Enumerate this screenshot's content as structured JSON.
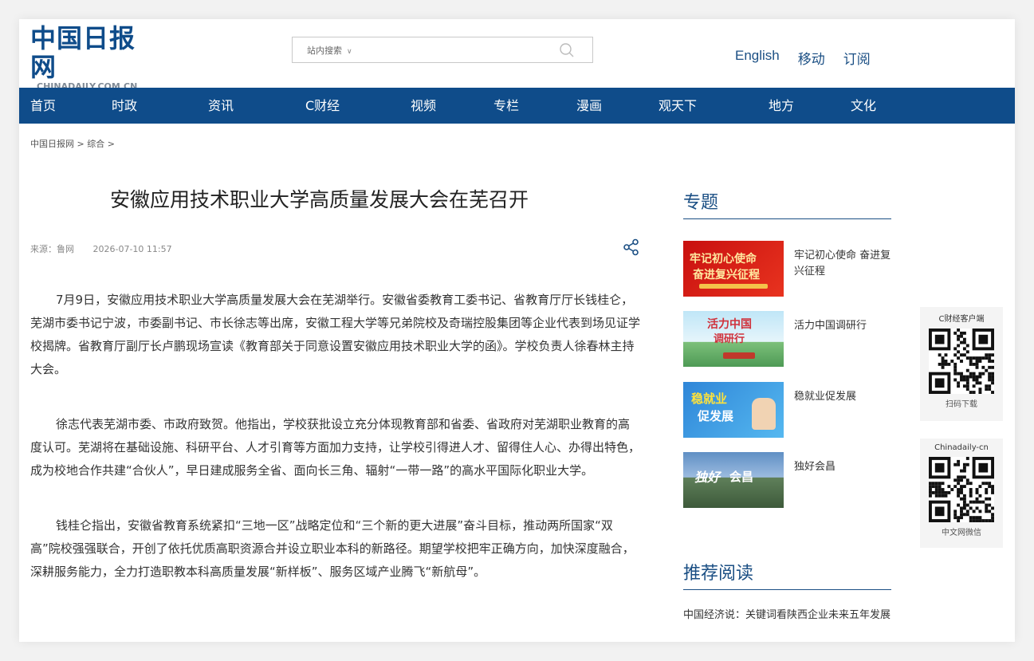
{
  "header": {
    "logo_cn": "中国日报网",
    "logo_en": "CHINADAILY.COM.CN",
    "search_scope": "站内搜索",
    "search_placeholder": "",
    "links": [
      "English",
      "移动",
      "订阅"
    ]
  },
  "nav": {
    "items": [
      "首页",
      "时政",
      "资讯",
      "C财经",
      "视频",
      "专栏",
      "漫画",
      "观天下",
      "地方",
      "文化"
    ]
  },
  "breadcrumb": {
    "home": "中国日报网",
    "sep1": ">",
    "section": "综合",
    "sep2": ">"
  },
  "article": {
    "title": "安徽应用技术职业大学高质量发展大会在芜召开",
    "source": "来源：鲁网",
    "date": "2026-07-10 11:57",
    "paragraphs": [
      "7月9日，安徽应用技术职业大学高质量发展大会在芜湖举行。安徽省委教育工委书记、省教育厅厅长钱桂仑，芜湖市委书记宁波，市委副书记、市长徐志等出席，安徽工程大学等兄弟院校及奇瑞控股集团等企业代表到场见证学校揭牌。省教育厅副厅长卢鹏现场宣读《教育部关于同意设置安徽应用技术职业大学的函》。学校负责人徐春林主持大会。",
      "徐志代表芜湖市委、市政府致贺。他指出，学校获批设立充分体现教育部和省委、省政府对芜湖职业教育的高度认可。芜湖将在基础设施、科研平台、人才引育等方面加力支持，让学校引得进人才、留得住人心、办得出特色，成为校地合作共建“合伙人”，早日建成服务全省、面向长三角、辐射“一带一路”的高水平国际化职业大学。",
      "钱桂仑指出，安徽省教育系统紧扣“三地一区”战略定位和“三个新的更大进展”奋斗目标，推动两所国家“双高”院校强强联合，开创了依托优质高职资源合并设立职业本科的新路径。期望学校把牢正确方向，加快深度融合，深耕服务能力，全力打造职教本科高质量发展“新样板”、服务区域产业腾飞“新航母”。"
    ]
  },
  "sidebar": {
    "topics_heading": "专题",
    "topics": [
      {
        "caption": "牢记初心使命 奋进复兴征程",
        "thumb_line1": "牢记初心使命",
        "thumb_line2": "奋进复兴征程"
      },
      {
        "caption": "活力中国调研行",
        "thumb_line1": "活力中国",
        "thumb_line2": "调研行"
      },
      {
        "caption": "稳就业促发展",
        "thumb_line1": "稳就业",
        "thumb_line2": "促发展"
      },
      {
        "caption": "独好会昌",
        "thumb_line1": "独好",
        "thumb_line2": "会昌"
      }
    ],
    "recommend_heading": "推荐阅读",
    "recommend_first": "中国经济说：关键词看陕西企业未来五年发展"
  },
  "qr": [
    {
      "label": "C财经客户端",
      "footer": "扫码下载"
    },
    {
      "label": "Chinadaily-cn",
      "footer": "中文网微信"
    }
  ],
  "colors": {
    "brand_blue": "#0f4c8a",
    "link_blue": "#1b4f84"
  }
}
